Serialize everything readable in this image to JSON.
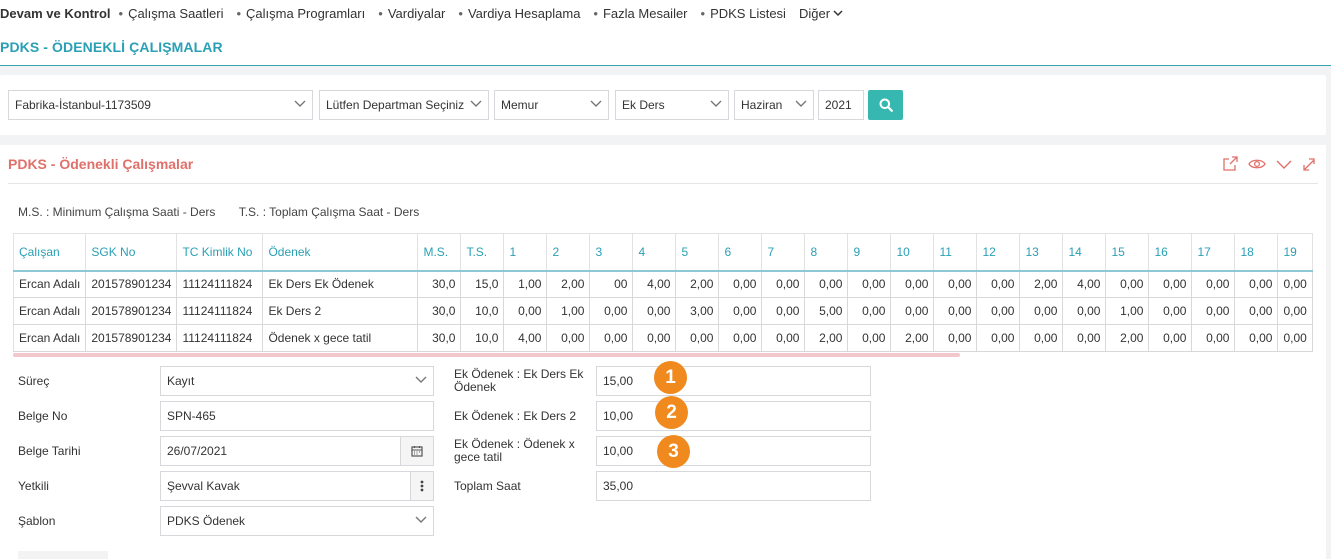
{
  "nav": {
    "items": [
      {
        "label": "Devam ve Kontrol",
        "bold": true
      },
      {
        "label": "Çalışma Saatleri"
      },
      {
        "label": "Çalışma Programları"
      },
      {
        "label": "Vardiyalar"
      },
      {
        "label": "Vardiya Hesaplama"
      },
      {
        "label": "Fazla Mesailer"
      },
      {
        "label": "PDKS Listesi"
      }
    ],
    "more_label": "Diğer"
  },
  "page_title": "PDKS - ÖDENEKLİ ÇALIŞMALAR",
  "filters": {
    "company": "Fabrika-İstanbul-1173509",
    "department": "Lütfen Departman Seçiniz",
    "staff_type": "Memur",
    "category": "Ek Ders",
    "month": "Haziran",
    "year": "2021"
  },
  "panel": {
    "title": "PDKS - Ödenekli Çalışmalar",
    "legend_ms": "M.S. : Minimum Çalışma Saati - Ders",
    "legend_ts": "T.S. : Toplam Çalışma Saat - Ders"
  },
  "table": {
    "headers": [
      "Çalışan",
      "SGK No",
      "TC Kimlik No",
      "Ödenek",
      "M.S.",
      "T.S.",
      "1",
      "2",
      "3",
      "4",
      "5",
      "6",
      "7",
      "8",
      "9",
      "10",
      "11",
      "12",
      "13",
      "14",
      "15",
      "16",
      "17",
      "18",
      "19"
    ],
    "rows": [
      [
        "Ercan Adalı",
        "201578901234",
        "11124111824",
        "Ek Ders Ek Ödenek",
        "30,0",
        "15,0",
        "1,00",
        "2,00",
        "00",
        "4,00",
        "2,00",
        "0,00",
        "0,00",
        "0,00",
        "0,00",
        "0,00",
        "0,00",
        "0,00",
        "2,00",
        "4,00",
        "0,00",
        "0,00",
        "0,00",
        "0,00",
        "0,00"
      ],
      [
        "Ercan Adalı",
        "201578901234",
        "11124111824",
        "Ek Ders 2",
        "30,0",
        "10,0",
        "0,00",
        "1,00",
        "0,00",
        "0,00",
        "3,00",
        "0,00",
        "0,00",
        "5,00",
        "0,00",
        "0,00",
        "0,00",
        "0,00",
        "0,00",
        "0,00",
        "1,00",
        "0,00",
        "0,00",
        "0,00",
        "0,00"
      ],
      [
        "Ercan Adalı",
        "201578901234",
        "11124111824",
        "Ödenek x gece tatil",
        "30,0",
        "10,0",
        "4,00",
        "0,00",
        "0,00",
        "0,00",
        "0,00",
        "0,00",
        "0,00",
        "2,00",
        "0,00",
        "2,00",
        "0,00",
        "0,00",
        "0,00",
        "0,00",
        "2,00",
        "0,00",
        "0,00",
        "0,00",
        "0,00"
      ]
    ]
  },
  "form": {
    "surec_label": "Süreç",
    "surec_value": "Kayıt",
    "belge_no_label": "Belge No",
    "belge_no_value": "SPN-465",
    "belge_tarihi_label": "Belge Tarihi",
    "belge_tarihi_value": "26/07/2021",
    "yetkili_label": "Yetkili",
    "yetkili_value": "Şevval Kavak",
    "sablon_label": "Şablon",
    "sablon_value": "PDKS Ödenek",
    "odenek1_label": "Ek Ödenek : Ek Ders Ek Ödenek",
    "odenek1_value": "15,00",
    "odenek2_label": "Ek Ödenek : Ek Ders 2",
    "odenek2_value": "10,00",
    "odenek3_label": "Ek Ödenek : Ödenek x gece tatil",
    "odenek3_value": "10,00",
    "toplam_label": "Toplam Saat",
    "toplam_value": "35,00"
  },
  "markers": [
    "1",
    "2",
    "3"
  ],
  "colors": {
    "accent_teal": "#2aa0b5",
    "search_button": "#36b8b0",
    "panel_title": "#e0706a",
    "marker_orange": "#f08a1e"
  }
}
